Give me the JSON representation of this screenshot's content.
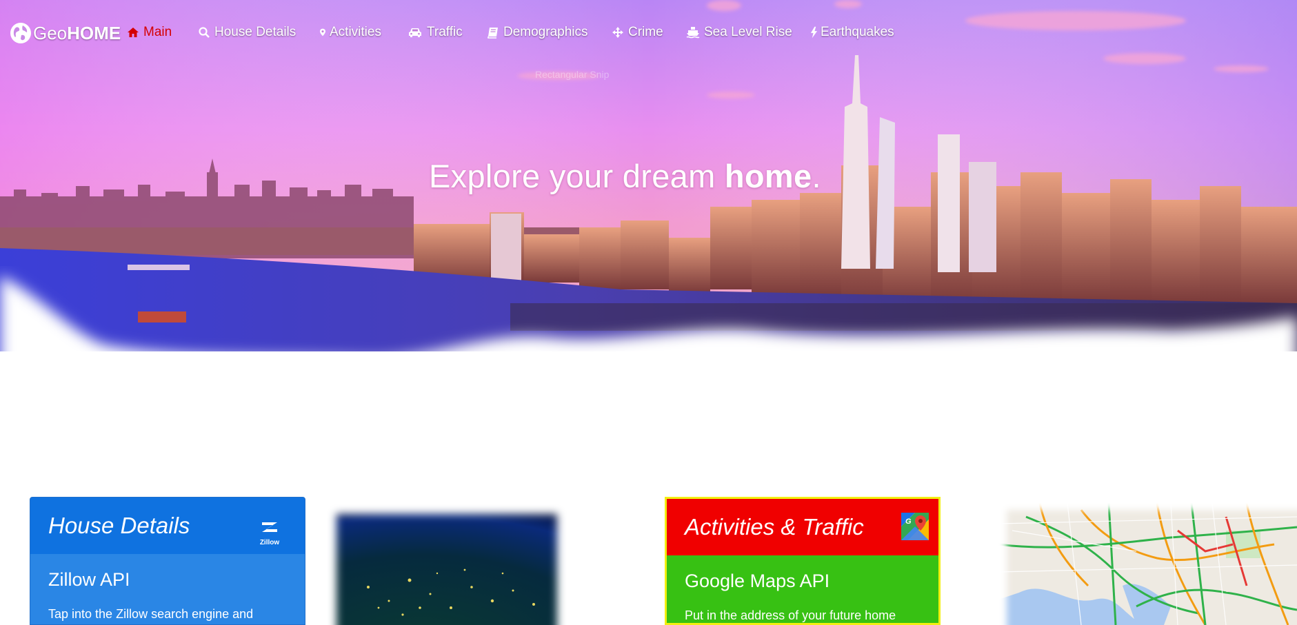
{
  "brand": {
    "prefix": "Geo",
    "suffix": "HOME"
  },
  "nav": {
    "main": "Main",
    "house_details": "House Details",
    "activities": "Activities",
    "traffic": "Traffic",
    "demographics": "Demographics",
    "crime": "Crime",
    "sea_level_rise": "Sea Level Rise",
    "earthquakes": "Earthquakes"
  },
  "hero": {
    "ghost_text": "Rectangular Snip",
    "tagline_prefix": "Explore your dream ",
    "tagline_bold": "home",
    "tagline_suffix": "."
  },
  "cards": {
    "house": {
      "title": "House Details",
      "logo_text": "Zillow",
      "subtitle": "Zillow API",
      "text": "Tap into the Zillow search engine and"
    },
    "activities": {
      "title": "Activities & Traffic",
      "subtitle": "Google Maps API",
      "text": "Put in the address of your future home"
    }
  },
  "colors": {
    "active_nav": "#d40000",
    "house_header": "#0f72e0",
    "house_body": "#2a86e5",
    "activities_header": "#f00000",
    "activities_body": "#37c113",
    "activities_border": "#f2ef11"
  }
}
